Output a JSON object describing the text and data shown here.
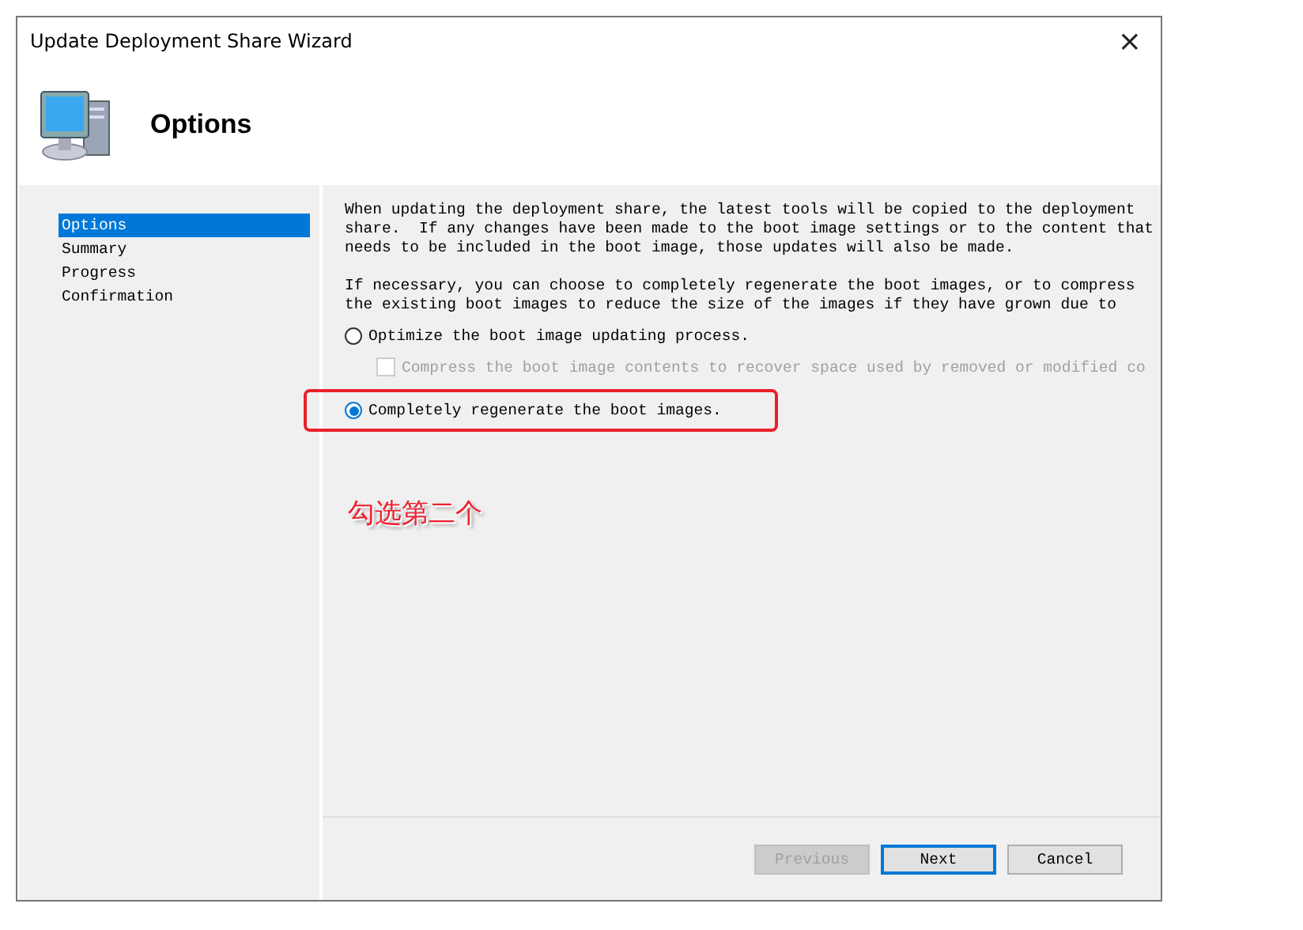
{
  "window": {
    "title": "Update Deployment Share Wizard",
    "close": "×"
  },
  "header": {
    "title": "Options"
  },
  "sidebar": {
    "items": [
      {
        "label": "Options",
        "selected": true
      },
      {
        "label": "Summary",
        "selected": false
      },
      {
        "label": "Progress",
        "selected": false
      },
      {
        "label": "Confirmation",
        "selected": false
      }
    ]
  },
  "content": {
    "paragraphs": [
      "When updating the deployment share, the latest tools will be copied to the deployment share.  If any changes have been made to the boot image settings or to the content that needs to be included in the boot image, those updates will also be made.",
      "If necessary, you can choose to completely regenerate the boot images, or to compress the existing boot images to reduce the size of the images if they have grown due to"
    ],
    "options": [
      {
        "kind": "radio",
        "label": "Optimize the boot image updating process.",
        "selected": false,
        "disabled": false,
        "highlighted": false
      },
      {
        "kind": "checkbox",
        "label": "Compress the boot image contents to recover space used by removed or modified co",
        "checked": false,
        "disabled": true,
        "highlighted": false
      },
      {
        "kind": "radio",
        "label": "Completely regenerate the boot images.",
        "selected": true,
        "disabled": false,
        "highlighted": true
      }
    ],
    "annotation": "勾选第二个"
  },
  "buttons": [
    {
      "label": "Previous",
      "disabled": true,
      "default": false
    },
    {
      "label": "Next",
      "disabled": false,
      "default": true
    },
    {
      "label": "Cancel",
      "disabled": false,
      "default": false
    }
  ]
}
